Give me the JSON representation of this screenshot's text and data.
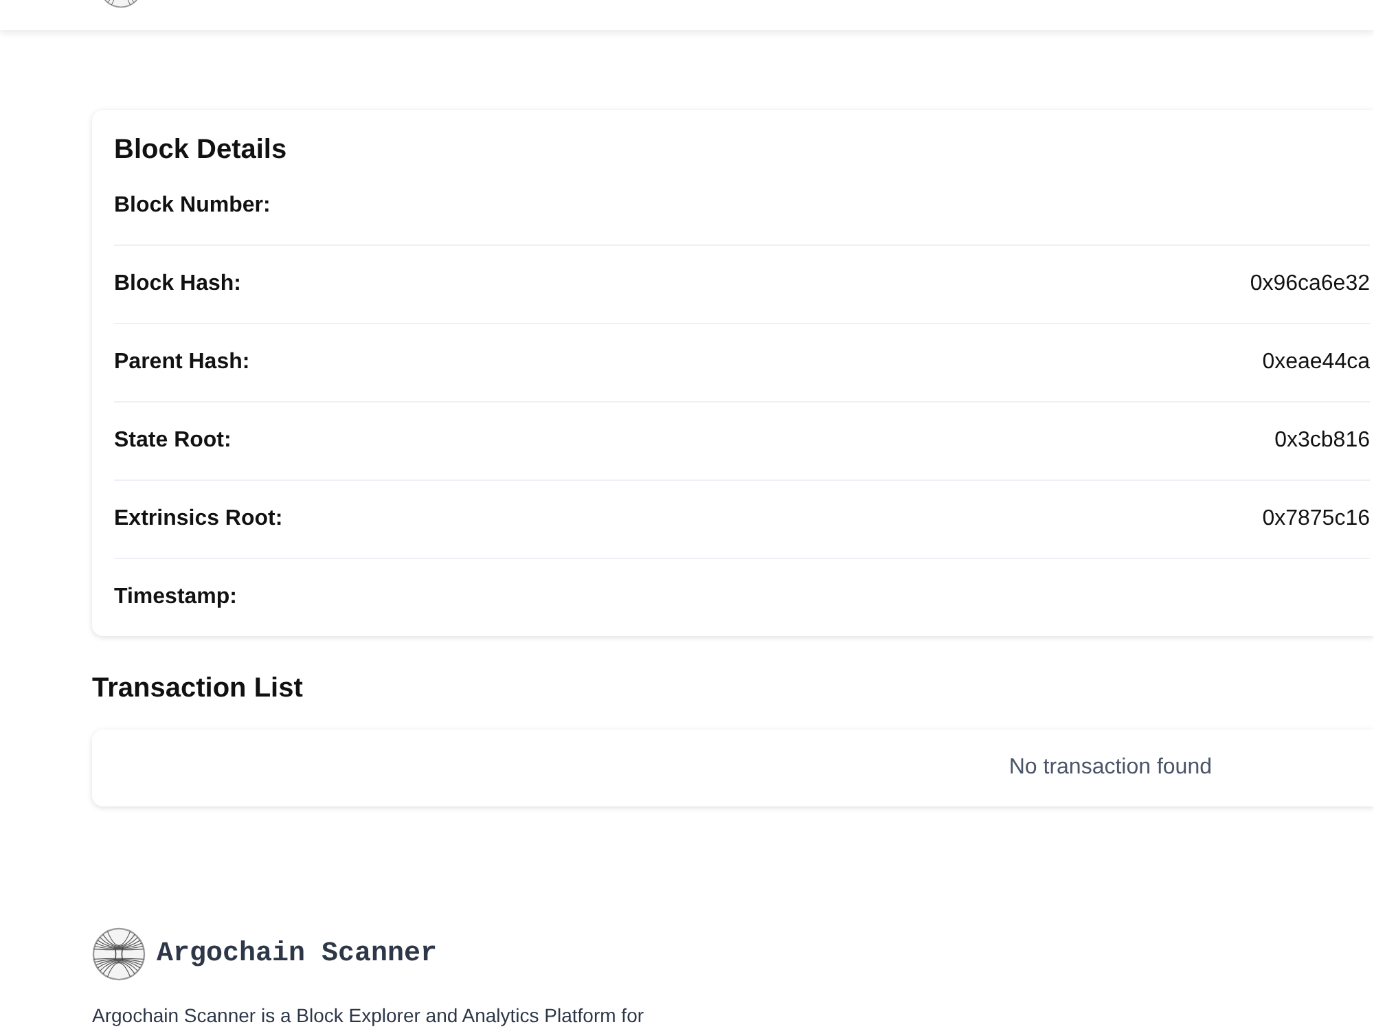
{
  "block_details": {
    "title": "Block Details",
    "rows": [
      {
        "label": "Block Number:"
      },
      {
        "label": "Block Hash:",
        "value": "0x96ca6e32"
      },
      {
        "label": "Parent Hash:",
        "value": "0xeae44ca"
      },
      {
        "label": "State Root:",
        "value": "0x3cb816"
      },
      {
        "label": "Extrinsics Root:",
        "value": "0x7875c16"
      },
      {
        "label": "Timestamp:"
      }
    ]
  },
  "transactions": {
    "title": "Transaction List",
    "empty_message": "No transaction found"
  },
  "footer": {
    "brand": "Argochain Scanner",
    "description": "Argochain Scanner is a Block Explorer and Analytics Platform for"
  }
}
